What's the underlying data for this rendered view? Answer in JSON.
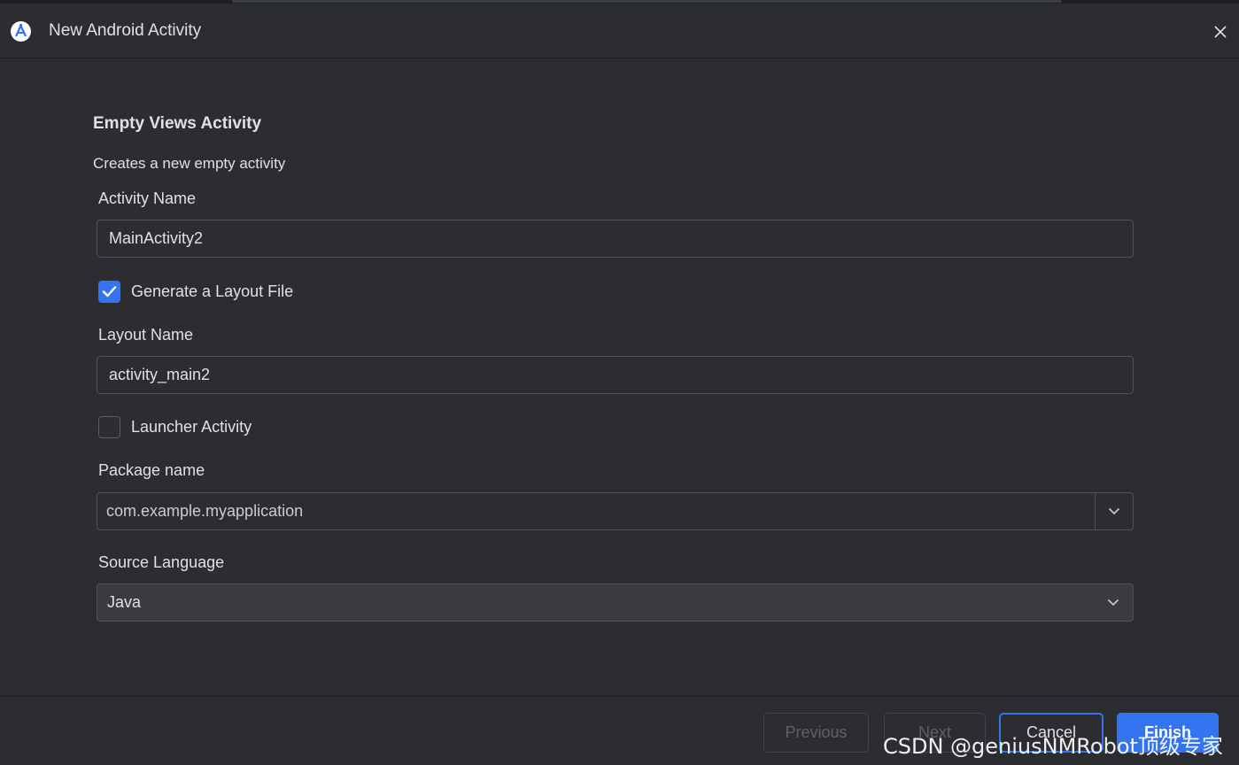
{
  "window": {
    "title": "New Android Activity",
    "app_icon": "android-studio-icon",
    "close_icon": "close-icon"
  },
  "template": {
    "name": "Empty Views Activity",
    "description": "Creates a new empty activity"
  },
  "form": {
    "activity_name": {
      "label": "Activity Name",
      "value": "MainActivity2"
    },
    "generate_layout": {
      "label": "Generate a Layout File",
      "checked": true
    },
    "layout_name": {
      "label": "Layout Name",
      "value": "activity_main2"
    },
    "launcher_activity": {
      "label": "Launcher Activity",
      "checked": false
    },
    "package_name": {
      "label": "Package name",
      "value": "com.example.myapplication",
      "arrow_icon": "chevron-down-icon"
    },
    "source_language": {
      "label": "Source Language",
      "value": "Java",
      "arrow_icon": "chevron-down-icon"
    }
  },
  "buttons": {
    "previous": "Previous",
    "next": "Next",
    "cancel": "Cancel",
    "finish": "Finish"
  },
  "watermark": "CSDN @geniusNMRobot顶级专家",
  "colors": {
    "background": "#2b2d30",
    "accent": "#3574f0",
    "border": "#4e5157",
    "text": "#dfe1e5"
  }
}
